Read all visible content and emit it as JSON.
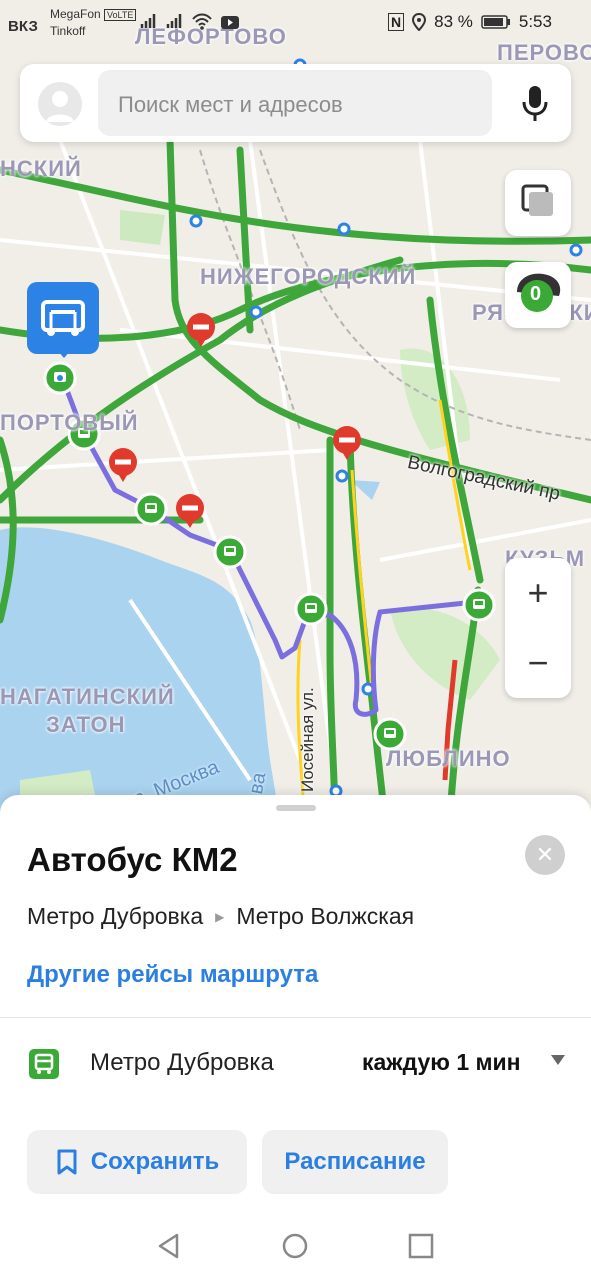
{
  "status_bar": {
    "carrier_label": "ВКЗ",
    "network_lines": [
      "MegaFon",
      "Tinkoff"
    ],
    "volte": "VoLTE",
    "battery_percent": "83 %",
    "time": "5:53"
  },
  "search": {
    "placeholder": "Поиск мест и адресов"
  },
  "map": {
    "districts": [
      "ЛЕФОРТОВО",
      "ПЕРОВО",
      "НИЖЕГОРОДСКИЙ",
      "РЯЗАНСКИЙ",
      "ЮЖНОПОРТОВЫЙ",
      "НАГАТИНСКИЙ ЗАТОН",
      "ЛЮБЛИНО",
      "КУЗЬМИНКИ"
    ],
    "labels": {
      "lefortovo": "ЛЕФОРТОВО",
      "perovo": "ПЕРОВО",
      "nizhegorodsky": "НИЖЕГОРОДСКИЙ",
      "ryazansky": "РЯЗАНСКИЙ",
      "yuzhnoportovy_top": "НСКИЙ",
      "yuzhnoportovy": "ПОРТОВЫЙ",
      "nagatinsky": "НАГАТИНСКИЙ",
      "zaton": "ЗАТОН",
      "lyublino": "ЛЮБЛИНО",
      "kuzminki": "КУЗЬМ",
      "volgogradsky": "Волгоградский пр",
      "kosseynaya": "Иосейная ул.",
      "river_moskva": "р. Москва",
      "river_va": "ва"
    },
    "traffic_level": "0",
    "accent_route_color": "#7b6fe0",
    "traffic_green": "#4caf3a"
  },
  "sheet": {
    "title": "Автобус КМ2",
    "from": "Метро Дубровка",
    "to": "Метро Волжская",
    "other_trips": "Другие рейсы маршрута",
    "stop_name": "Метро Дубровка",
    "frequency": "каждую 1 мин",
    "save_label": "Сохранить",
    "schedule_label": "Расписание"
  }
}
